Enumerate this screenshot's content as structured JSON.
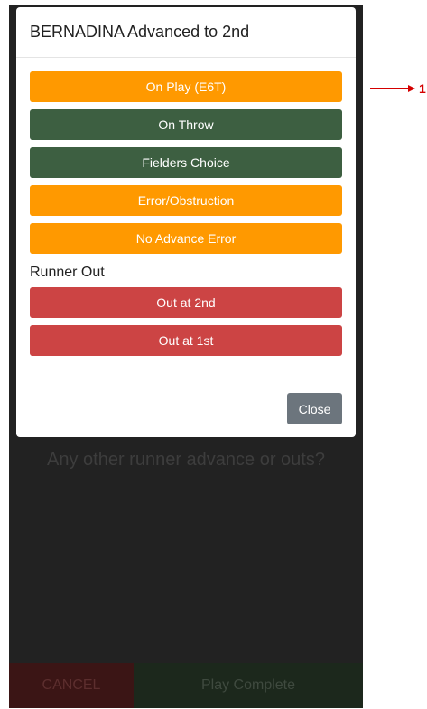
{
  "background": {
    "question": "Any other runner advance or outs?",
    "cancel_label": "CANCEL",
    "complete_label": "Play Complete"
  },
  "modal": {
    "title": "BERNADINA Advanced to 2nd",
    "advance_buttons": [
      {
        "label": "On Play (E6T)",
        "color": "#ff9900"
      },
      {
        "label": "On Throw",
        "color": "#3d5f41"
      },
      {
        "label": "Fielders Choice",
        "color": "#3d5f41"
      },
      {
        "label": "Error/Obstruction",
        "color": "#ff9900"
      },
      {
        "label": "No Advance Error",
        "color": "#ff9900"
      }
    ],
    "runner_out_title": "Runner Out",
    "out_buttons": [
      {
        "label": "Out at 2nd",
        "color": "#cc4444"
      },
      {
        "label": "Out at 1st",
        "color": "#cc4444"
      }
    ],
    "close_label": "Close"
  },
  "annotation": {
    "number": "1",
    "color": "#d40000"
  }
}
